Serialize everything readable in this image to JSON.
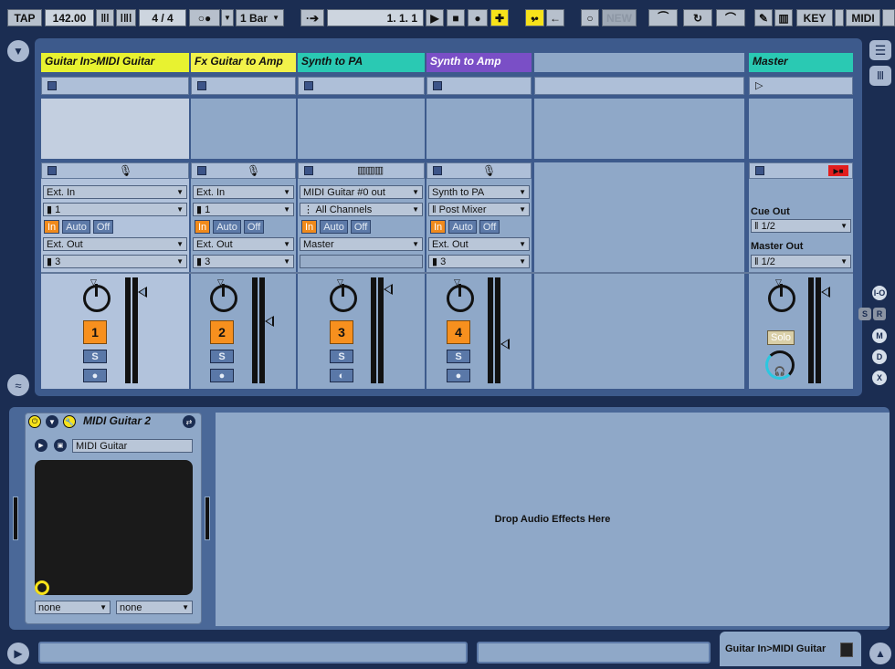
{
  "transport": {
    "tap": "TAP",
    "tempo": "142.00",
    "signature": "4  /  4",
    "quantize": "1 Bar",
    "position": "1.    1.    1",
    "new_label": "NEW",
    "key_label": "KEY",
    "midi_label": "MIDI"
  },
  "tracks": [
    {
      "name": "Guitar In>MIDI Guitar",
      "color": "#e8f230",
      "text_color": "#111111",
      "input_type": "Ext. In",
      "input_channel": "1",
      "monitor": [
        "In",
        "Auto",
        "Off"
      ],
      "output_type": "Ext. Out",
      "output_channel": "3",
      "number": "1",
      "solo": "S"
    },
    {
      "name": "Fx Guitar to Amp",
      "color": "#f2f24a",
      "text_color": "#111111",
      "input_type": "Ext. In",
      "input_channel": "1",
      "monitor": [
        "In",
        "Auto",
        "Off"
      ],
      "output_type": "Ext. Out",
      "output_channel": "3",
      "number": "2",
      "solo": "S"
    },
    {
      "name": "Synth to PA",
      "color": "#2ac9b3",
      "text_color": "#111111",
      "input_type": "MIDI Guitar #0 out",
      "input_channel": "All Channels",
      "monitor": [
        "In",
        "Auto",
        "Off"
      ],
      "output_type": "Master",
      "output_channel": "",
      "number": "3",
      "solo": "S"
    },
    {
      "name": "Synth to Amp",
      "color": "#7a4fc6",
      "text_color": "#ffffff",
      "input_type": "Synth to PA",
      "input_channel": "Post Mixer",
      "monitor": [
        "In",
        "Auto",
        "Off"
      ],
      "output_type": "Ext. Out",
      "output_channel": "3",
      "number": "4",
      "solo": "S"
    }
  ],
  "master": {
    "name": "Master",
    "color": "#2ac9b3",
    "cue_out_label": "Cue Out",
    "cue_out_value": "1/2",
    "master_out_label": "Master Out",
    "master_out_value": "1/2",
    "solo_label": "Solo"
  },
  "side_buttons": [
    "I-O",
    "S",
    "R",
    "M",
    "D",
    "X"
  ],
  "device": {
    "title": "MIDI Guitar 2",
    "preset": "MIDI Guitar",
    "select_left": "none",
    "select_right": "none"
  },
  "drop_area": {
    "label": "Drop Audio Effects Here"
  },
  "status": {
    "selected_track": "Guitar In>MIDI Guitar"
  },
  "colors": {
    "accent_orange": "#f7901e",
    "accent_yellow": "#f7e21a",
    "background": "#1b2d52"
  }
}
